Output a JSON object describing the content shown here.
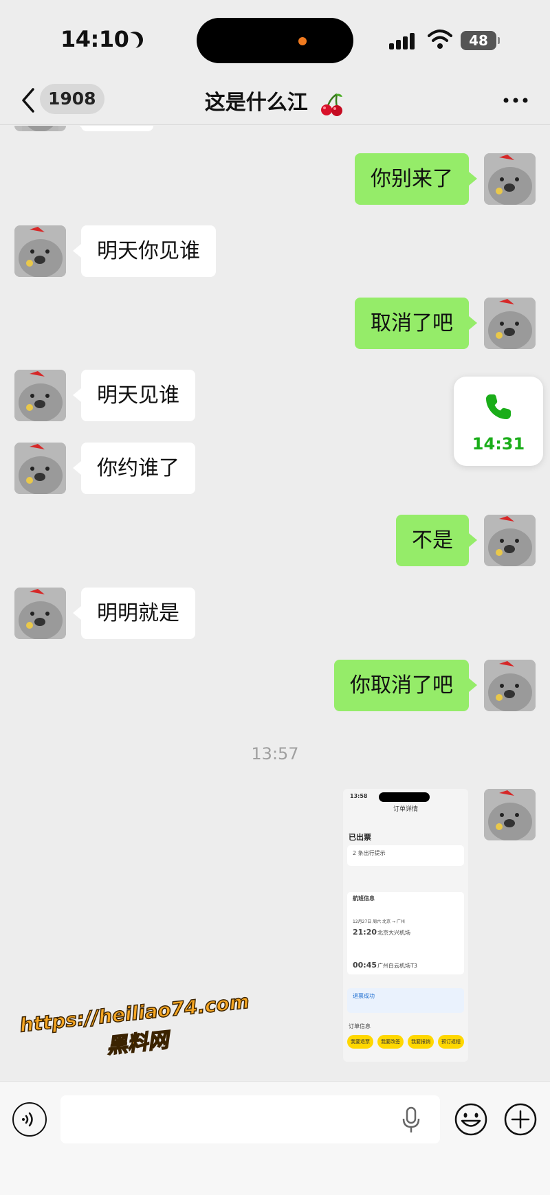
{
  "status_bar": {
    "time": "14:10",
    "battery": "48",
    "icons": [
      "moon-icon",
      "signal-icon",
      "wifi-icon",
      "battery-icon"
    ]
  },
  "nav": {
    "back_badge": "1908",
    "title": "这是什么江",
    "title_icon": "cherry-icon",
    "more_icon": "more-icon"
  },
  "messages": [
    {
      "side": "right",
      "text": "你别来了"
    },
    {
      "side": "left",
      "text": "明天你见谁"
    },
    {
      "side": "right",
      "text": "取消了吧"
    },
    {
      "side": "left",
      "text": "明天见谁"
    },
    {
      "side": "left",
      "text": "你约谁了"
    },
    {
      "side": "right",
      "text": "不是"
    },
    {
      "side": "left",
      "text": "明明就是"
    },
    {
      "side": "right",
      "text": "你取消了吧"
    }
  ],
  "timestamp": "13:57",
  "image_message": {
    "status_time": "13:58",
    "header": "订单详情",
    "status": "已出票",
    "reminder": "2 条出行提示",
    "section": "航班信息",
    "date_route": "12月27日 周六 北京 → 广州",
    "depart_time": "21:20",
    "depart_airport": "北京大兴机场",
    "arrive_time": "00:45",
    "arrive_airport": "广州白云机场T3",
    "result": "退票成功",
    "order_section": "订单信息",
    "buttons": [
      "我要退票",
      "我要改签",
      "我要报销",
      "预订返程"
    ]
  },
  "call_card": {
    "icon": "phone-icon",
    "duration": "14:31",
    "accent": "#1aad19"
  },
  "watermark": {
    "url": "https://heiliao74.com",
    "name": "黑料网"
  },
  "input_bar": {
    "placeholder": "",
    "icons": [
      "voice-icon",
      "mic-icon",
      "emoji-icon",
      "plus-icon"
    ]
  },
  "colors": {
    "sent_bubble": "#95ec69",
    "received_bubble": "#ffffff",
    "background": "#ededed"
  }
}
